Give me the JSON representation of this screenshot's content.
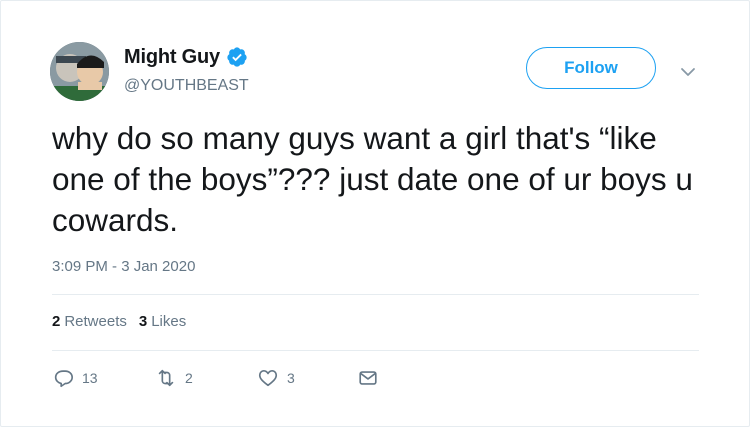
{
  "author": {
    "display_name": "Might Guy",
    "handle": "@YOUTHBEAST",
    "verified": true
  },
  "follow_button": {
    "label": "Follow"
  },
  "tweet": {
    "text": "why do so many guys want a girl that's “like one of the boys”??? just date one of ur boys u cowards.",
    "timestamp": "3:09 PM - 3 Jan 2020"
  },
  "stats": {
    "retweets_count": "2",
    "retweets_label": "Retweets",
    "likes_count": "3",
    "likes_label": "Likes"
  },
  "actions": {
    "reply_count": "13",
    "retweet_count": "2",
    "like_count": "3"
  },
  "icons": {
    "reply": "reply-icon",
    "retweet": "retweet-icon",
    "like": "heart-icon",
    "message": "envelope-icon",
    "verified": "verified-badge-icon",
    "menu": "chevron-down-icon"
  },
  "colors": {
    "accent": "#1da1f2",
    "text_primary": "#14171a",
    "text_secondary": "#657786",
    "divider": "#e6ecf0"
  }
}
